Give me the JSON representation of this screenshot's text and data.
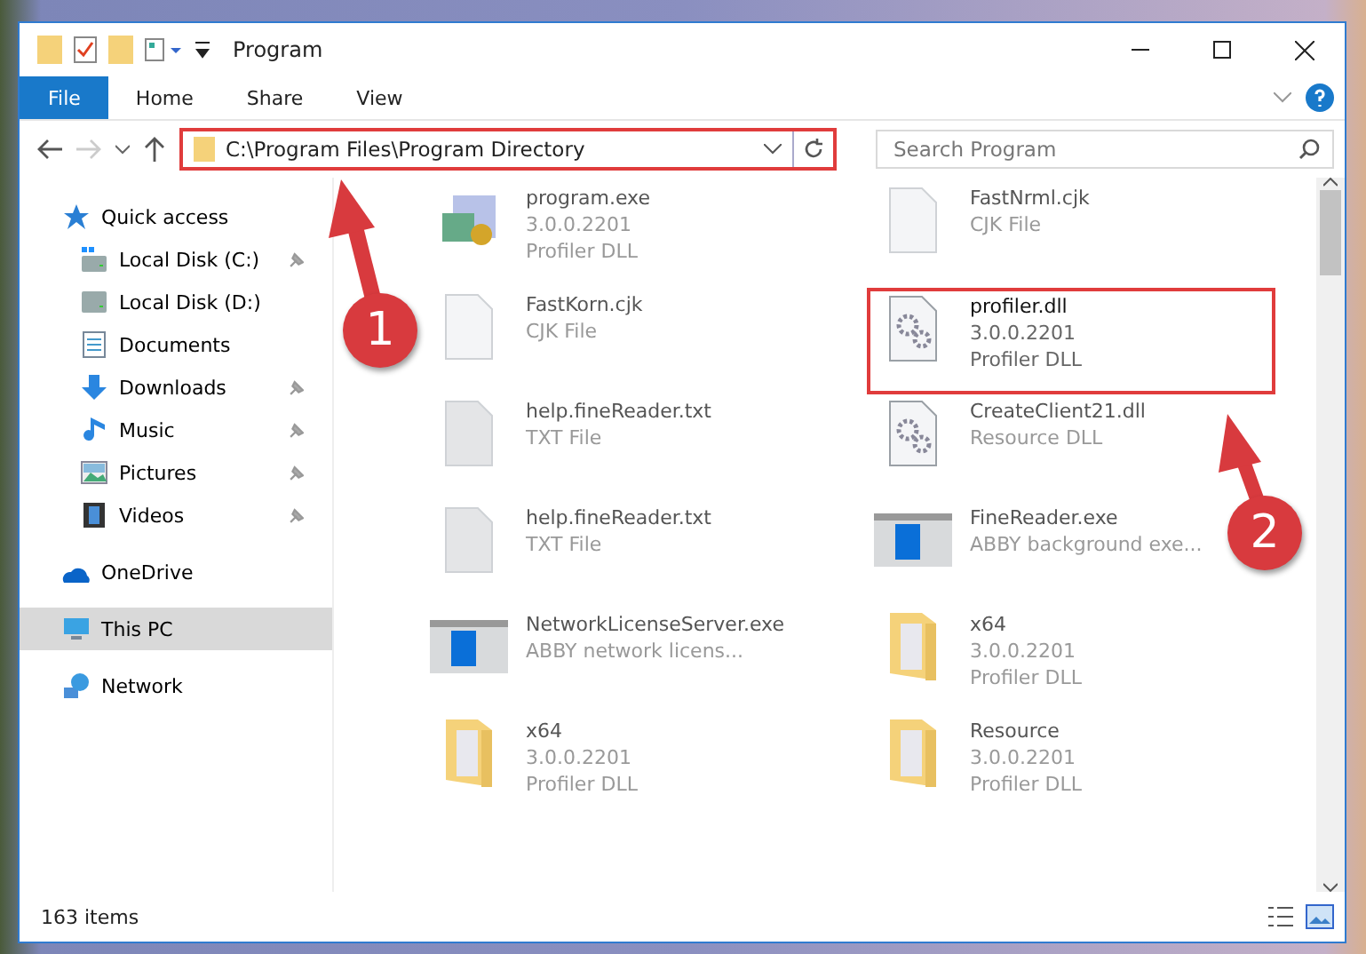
{
  "window": {
    "title": "Program"
  },
  "ribbon": {
    "tabs": [
      {
        "label": "File",
        "selected": true
      },
      {
        "label": "Home",
        "selected": false
      },
      {
        "label": "Share",
        "selected": false
      },
      {
        "label": "View",
        "selected": false
      }
    ]
  },
  "address": {
    "path": "C:\\Program Files\\Program Directory",
    "highlighted": true
  },
  "search": {
    "placeholder": "Search Program"
  },
  "sidebar": {
    "items": [
      {
        "label": "Quick access",
        "kind": "star",
        "pinned": false,
        "selected": false,
        "children": [
          {
            "label": "Local Disk (C:)",
            "kind": "drive-c",
            "pinned": true,
            "selected": false
          },
          {
            "label": "Local Disk (D:)",
            "kind": "drive",
            "pinned": false,
            "selected": false
          },
          {
            "label": "Documents",
            "kind": "documents",
            "pinned": false,
            "selected": false
          },
          {
            "label": "Downloads",
            "kind": "downloads",
            "pinned": true,
            "selected": false
          },
          {
            "label": "Music",
            "kind": "music",
            "pinned": true,
            "selected": false
          },
          {
            "label": "Pictures",
            "kind": "pictures",
            "pinned": true,
            "selected": false
          },
          {
            "label": "Videos",
            "kind": "videos",
            "pinned": true,
            "selected": false
          }
        ]
      },
      {
        "label": "OneDrive",
        "kind": "cloud",
        "pinned": false,
        "selected": false
      },
      {
        "label": "This PC",
        "kind": "pc",
        "pinned": false,
        "selected": true
      },
      {
        "label": "Network",
        "kind": "network",
        "pinned": false,
        "selected": false
      }
    ]
  },
  "files": [
    {
      "name": "program.exe",
      "kind": "exe",
      "details": [
        "3.0.0.2201",
        "Profiler DLL"
      ],
      "highlighted": false
    },
    {
      "name": "FastNrml.cjk",
      "kind": "file",
      "details": [
        "CJK File"
      ],
      "highlighted": false
    },
    {
      "name": "FastKorn.cjk",
      "kind": "file",
      "details": [
        "CJK File"
      ],
      "highlighted": false
    },
    {
      "name": "profiler.dll",
      "kind": "dll",
      "details": [
        "3.0.0.2201",
        "Profiler DLL"
      ],
      "highlighted": true
    },
    {
      "name": "help.fineReader.txt",
      "kind": "text",
      "details": [
        "TXT File"
      ],
      "highlighted": false
    },
    {
      "name": "CreateClient21.dll",
      "kind": "dll",
      "details": [
        "Resource DLL"
      ],
      "highlighted": false
    },
    {
      "name": "help.fineReader.txt",
      "kind": "text",
      "details": [
        "TXT File"
      ],
      "highlighted": false
    },
    {
      "name": "FineReader.exe",
      "kind": "app",
      "details": [
        "ABBY background exe..."
      ],
      "highlighted": false
    },
    {
      "name": "NetworkLicenseServer.exe",
      "kind": "app",
      "details": [
        "ABBY network licens..."
      ],
      "highlighted": false
    },
    {
      "name": "x64",
      "kind": "folder",
      "details": [
        "3.0.0.2201",
        "Profiler DLL"
      ],
      "highlighted": false
    },
    {
      "name": "x64",
      "kind": "folder",
      "details": [
        "3.0.0.2201",
        "Profiler DLL"
      ],
      "highlighted": false
    },
    {
      "name": "Resource",
      "kind": "folder",
      "details": [
        "3.0.0.2201",
        "Profiler DLL"
      ],
      "highlighted": false
    }
  ],
  "status_bar": {
    "count": "163 items"
  },
  "annotations": [
    {
      "number": "1"
    },
    {
      "number": "2"
    }
  ]
}
